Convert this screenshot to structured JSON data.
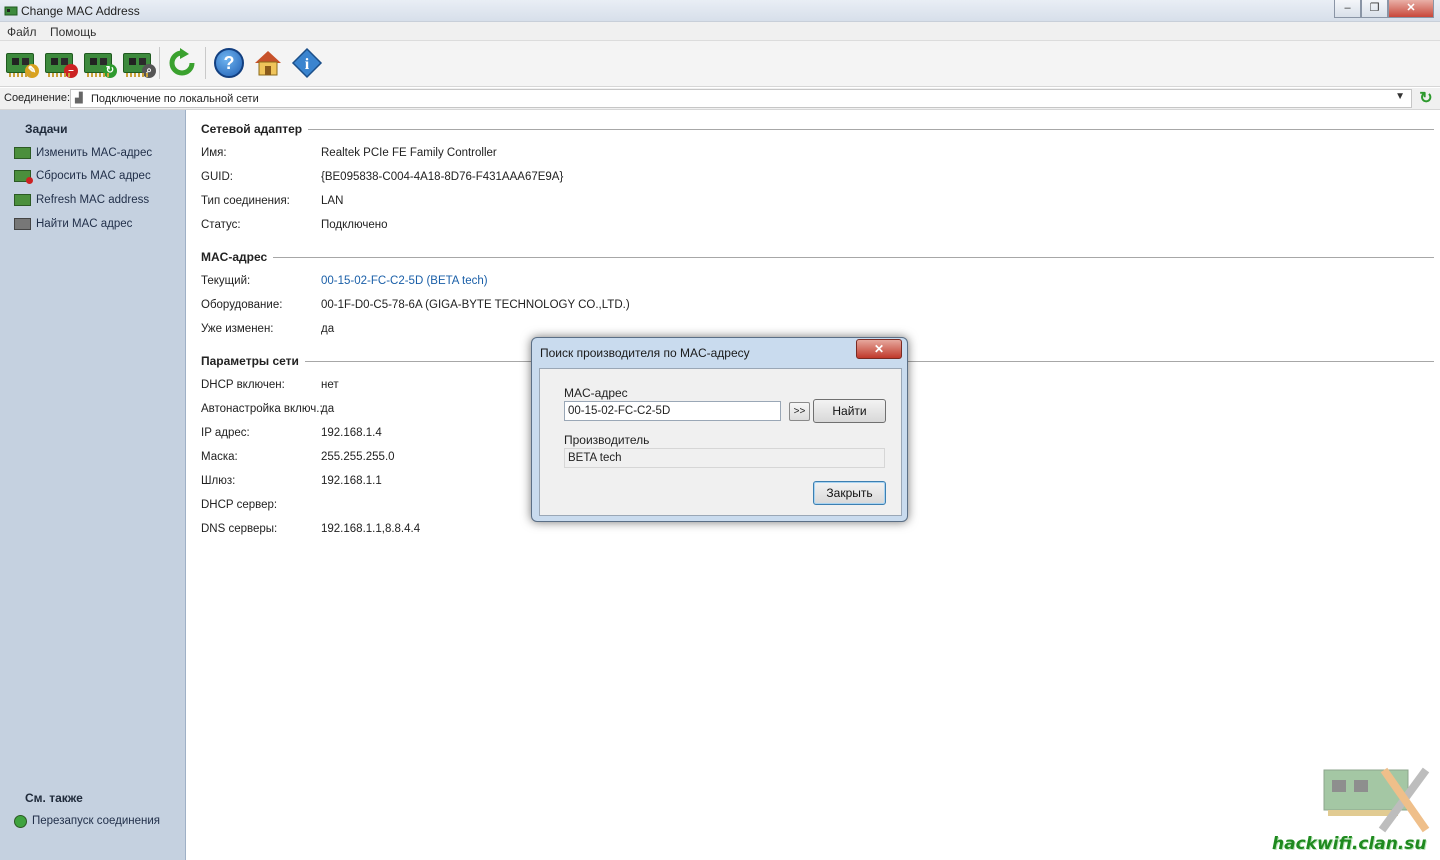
{
  "window": {
    "title": "Change MAC Address",
    "minimize": "–",
    "maximize": "❐",
    "close": "✕"
  },
  "menu": {
    "file": "Файл",
    "help": "Помощь"
  },
  "toolbar": {
    "buttons": [
      {
        "name": "change-mac",
        "icon": "nic-edit-icon"
      },
      {
        "name": "reset-mac",
        "icon": "nic-remove-icon"
      },
      {
        "name": "refresh-mac",
        "icon": "nic-refresh-icon"
      },
      {
        "name": "find-mac",
        "icon": "nic-search-icon"
      },
      {
        "name": "refresh",
        "icon": "refresh-icon"
      },
      {
        "name": "help",
        "icon": "help-icon",
        "glyph": "?"
      },
      {
        "name": "home",
        "icon": "home-icon"
      },
      {
        "name": "about",
        "icon": "info-icon",
        "glyph": "i"
      }
    ]
  },
  "connection": {
    "label": "Соединение:",
    "value": "Подключение по локальной сети"
  },
  "sidebar": {
    "tasks_title": "Задачи",
    "tasks": [
      {
        "label": "Изменить MAC-адрес"
      },
      {
        "label": "Сбросить MAC адрес"
      },
      {
        "label": "Refresh MAC address"
      },
      {
        "label": "Найти MAC адрес"
      }
    ],
    "see_also_title": "См. также",
    "see_also": [
      {
        "label": "Перезапуск соединения"
      }
    ]
  },
  "adapter": {
    "title": "Сетевой адаптер",
    "rows": [
      {
        "label": "Имя:",
        "value": "Realtek PCIe FE Family Controller"
      },
      {
        "label": "GUID:",
        "value": "{BE095838-C004-4A18-8D76-F431AAA67E9A}"
      },
      {
        "label": "Тип соединения:",
        "value": "LAN"
      },
      {
        "label": "Статус:",
        "value": "Подключено"
      }
    ]
  },
  "mac": {
    "title": "MAC-адрес",
    "rows": [
      {
        "label": "Текущий:",
        "value": "00-15-02-FC-C2-5D (BETA tech)"
      },
      {
        "label": "Оборудование:",
        "value": "00-1F-D0-C5-78-6A (GIGA-BYTE TECHNOLOGY CO.,LTD.)"
      },
      {
        "label": "Уже изменен:",
        "value": "да"
      }
    ]
  },
  "network": {
    "title": "Параметры сети",
    "rows": [
      {
        "label": "DHCP включен:",
        "value": "нет"
      },
      {
        "label": "Автонастройка включ.:",
        "value": "да"
      },
      {
        "label": "IP адрес:",
        "value": "192.168.1.4"
      },
      {
        "label": "Маска:",
        "value": "255.255.255.0"
      },
      {
        "label": "Шлюз:",
        "value": "192.168.1.1"
      },
      {
        "label": "DHCP сервер:",
        "value": ""
      },
      {
        "label": "DNS серверы:",
        "value": "192.168.1.1,8.8.4.4"
      }
    ]
  },
  "dialog": {
    "title": "Поиск производителя по MAC-адресу",
    "close": "✕",
    "mac_label": "MAC-адрес",
    "mac_value": "00-15-02-FC-C2-5D",
    "arrow_button": ">>",
    "find_button": "Найти",
    "vendor_label": "Производитель",
    "vendor_value": "BETA tech",
    "close_button": "Закрыть"
  },
  "watermark": {
    "text": "hackwifi.clan.su"
  },
  "colors": {
    "sidebar_bg": "#c5d1e0",
    "link": "#1a5fa8",
    "dialog_frame": "#c9dbee",
    "watermark": "#1f8a1f"
  }
}
